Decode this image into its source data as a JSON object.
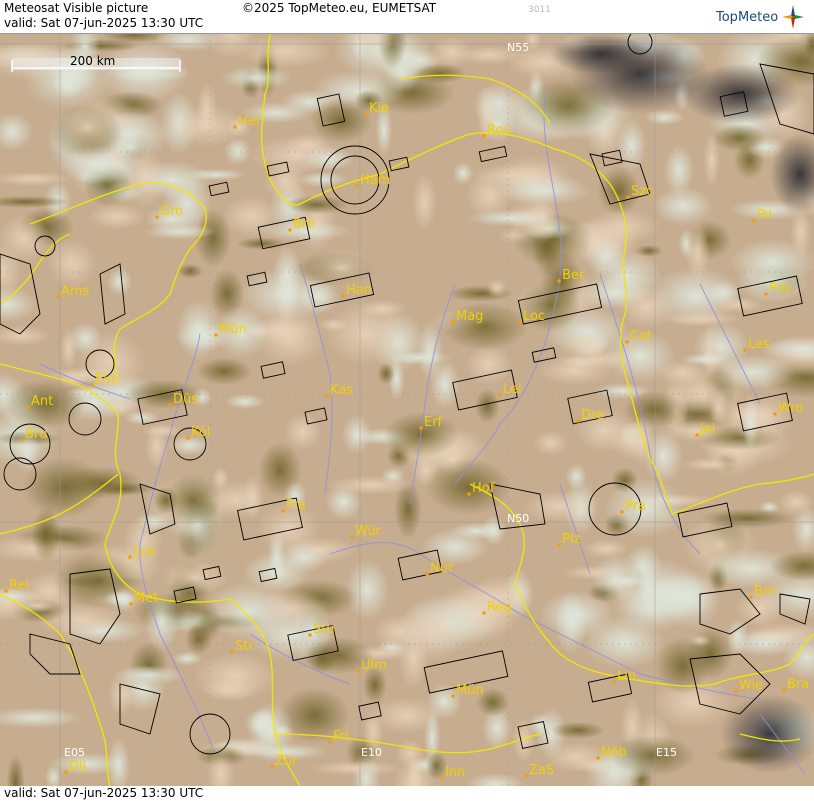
{
  "header": {
    "title": "Meteosat Visible picture",
    "valid_line": "valid:  Sat  07-jun-2025  13:30 UTC",
    "copyright": "©2025 TopMeteo.eu, EUMETSAT",
    "code": "3011",
    "logo_text": "TopMeteo"
  },
  "footer": {
    "valid_line": "valid:  Sat  07-jun-2025  13:30 UTC"
  },
  "scale_bar": {
    "label": "200 km"
  },
  "grid_labels": [
    "N55",
    "N50",
    "E05",
    "E10",
    "E15"
  ],
  "cities": [
    "Hel",
    "Kie",
    "Ros",
    "Ham",
    "Szc",
    "Gro",
    "Bre",
    "Pil",
    "Ams",
    "Han",
    "Ber",
    "Poz",
    "Mag",
    "Loc",
    "Mün",
    "Cot",
    "Les",
    "Ein",
    "Ant",
    "Düs",
    "Kas",
    "Lei",
    "Wro",
    "Bru",
    "Köl",
    "Erf",
    "Dre",
    "Jel",
    "Hof",
    "Fra",
    "Pra",
    "Lux",
    "Wür",
    "Plz",
    "Rei",
    "Nür",
    "Met",
    "Reg",
    "Brn",
    "Stu",
    "Str",
    "Ulm",
    "Lin",
    "Mün",
    "Wie",
    "Bra",
    "Fri",
    "Zür",
    "Inn",
    "ZaS",
    "Nöb",
    "Dij"
  ],
  "colors": {
    "border": "#f2e600",
    "rivers": "#8f8fe0",
    "city_text": "#f2d000",
    "airspace": "#000000"
  }
}
